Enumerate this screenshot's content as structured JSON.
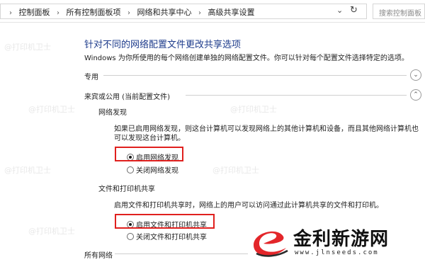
{
  "address_bar": {
    "breadcrumbs": [
      "控制面板",
      "所有控制面板项",
      "网络和共享中心",
      "高级共享设置"
    ],
    "search_placeholder": "搜索控制面板"
  },
  "page": {
    "title": "针对不同的网络配置文件更改共享选项",
    "description": "Windows 为你所使用的每个网络创建单独的网络配置文件。你可以针对每个配置文件选择特定的选项。"
  },
  "profiles": {
    "private": {
      "label": "专用",
      "expanded": false
    },
    "guest_public": {
      "label": "来宾或公用 (当前配置文件)",
      "expanded": true
    },
    "all_networks": {
      "label": "所有网络"
    }
  },
  "network_discovery": {
    "heading": "网络发现",
    "text": "如果已启用网络发现，则这台计算机可以发现网络上的其他计算机和设备，而且其他网络计算机也可以发现这台计算机。",
    "options": [
      {
        "label": "启用网络发现",
        "checked": true
      },
      {
        "label": "关闭网络发现",
        "checked": false
      }
    ]
  },
  "file_printer_sharing": {
    "heading": "文件和打印机共享",
    "text": "启用文件和打印机共享时，网络上的用户可以访问通过此计算机共享的文件和打印机。",
    "options": [
      {
        "label": "启用文件和打印机共享",
        "checked": true
      },
      {
        "label": "关闭文件和打印机共享",
        "checked": false
      }
    ]
  },
  "watermark": {
    "text": "@打印机卫士"
  },
  "logo": {
    "name": "金利新游网",
    "url": "www.jlnseeds.com"
  },
  "colors": {
    "title_blue": "#1e3c8c",
    "highlight_red": "#e0201e",
    "logo_red": "#e3262a"
  }
}
